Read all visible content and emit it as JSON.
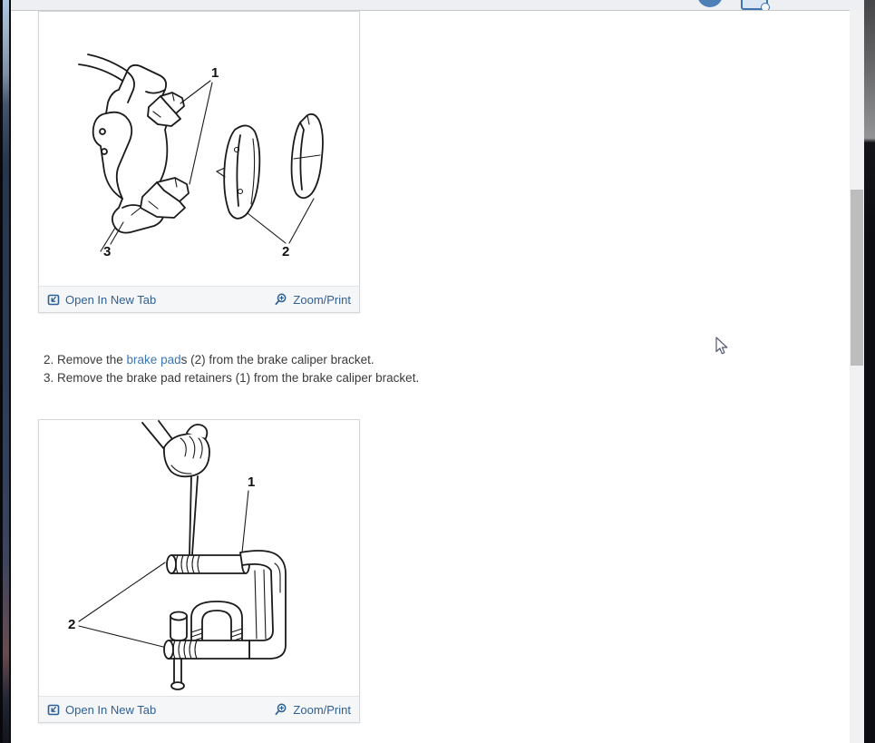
{
  "toolbar": {
    "avatar_icon": "user-avatar",
    "help_icon": "printer-help"
  },
  "panels": [
    {
      "name": "brake-pads-exploded-view",
      "open_label": "Open In New Tab",
      "zoom_label": "Zoom/Print",
      "callouts": [
        "1",
        "2",
        "3"
      ]
    },
    {
      "name": "caliper-piston-compress",
      "open_label": "Open In New Tab",
      "zoom_label": "Zoom/Print",
      "callouts": [
        "1",
        "2"
      ]
    }
  ],
  "steps": [
    {
      "prefix": "2. Remove the ",
      "link_text": "brake pad",
      "suffix": "s (2) from the brake caliper bracket."
    },
    {
      "text": "3. Remove the brake pad retainers (1) from the brake caliper bracket."
    }
  ],
  "colors": {
    "footer_link": "#2e5f94",
    "inline_link": "#3a77b5",
    "toolbar_accent": "#4d7fb7",
    "scroll_thumb": "#bdbdbd"
  }
}
